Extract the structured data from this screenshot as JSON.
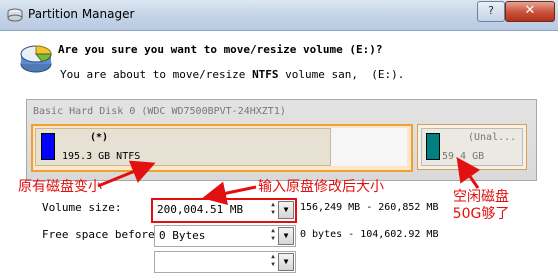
{
  "window": {
    "title": "Partition Manager",
    "help_label": "?",
    "close_label": "✕"
  },
  "dialog": {
    "question": "Are you sure you want to move/resize volume (E:)?",
    "subtext_prefix": "You are about to move/resize ",
    "subtext_fs": "NTFS",
    "subtext_suffix": " volume san,  (E:)."
  },
  "disk": {
    "label": "Basic Hard Disk 0 (WDC WD7500BPVT-24HXZT1)",
    "partitions": [
      {
        "name": "(*)",
        "size": "195.3 GB NTFS",
        "color": "#0000ff"
      },
      {
        "name": "(Unal...",
        "size": "59.4 GB",
        "color": "#008080"
      }
    ]
  },
  "annotations": {
    "left": "原有磁盘变小",
    "middle": "输入原盘修改后大小",
    "right_line1": "空闲磁盘",
    "right_line2": "50G够了"
  },
  "fields": {
    "volume_size": {
      "label": "Volume size:",
      "value": "200,004.51 MB",
      "range": "156,249 MB - 260,852 MB"
    },
    "free_space_before": {
      "label": "Free space before:",
      "value": "0 Bytes",
      "range": "0 bytes - 104,602.92 MB"
    }
  },
  "colors": {
    "annotation": "#e21010",
    "selection_border": "#f0a030"
  }
}
